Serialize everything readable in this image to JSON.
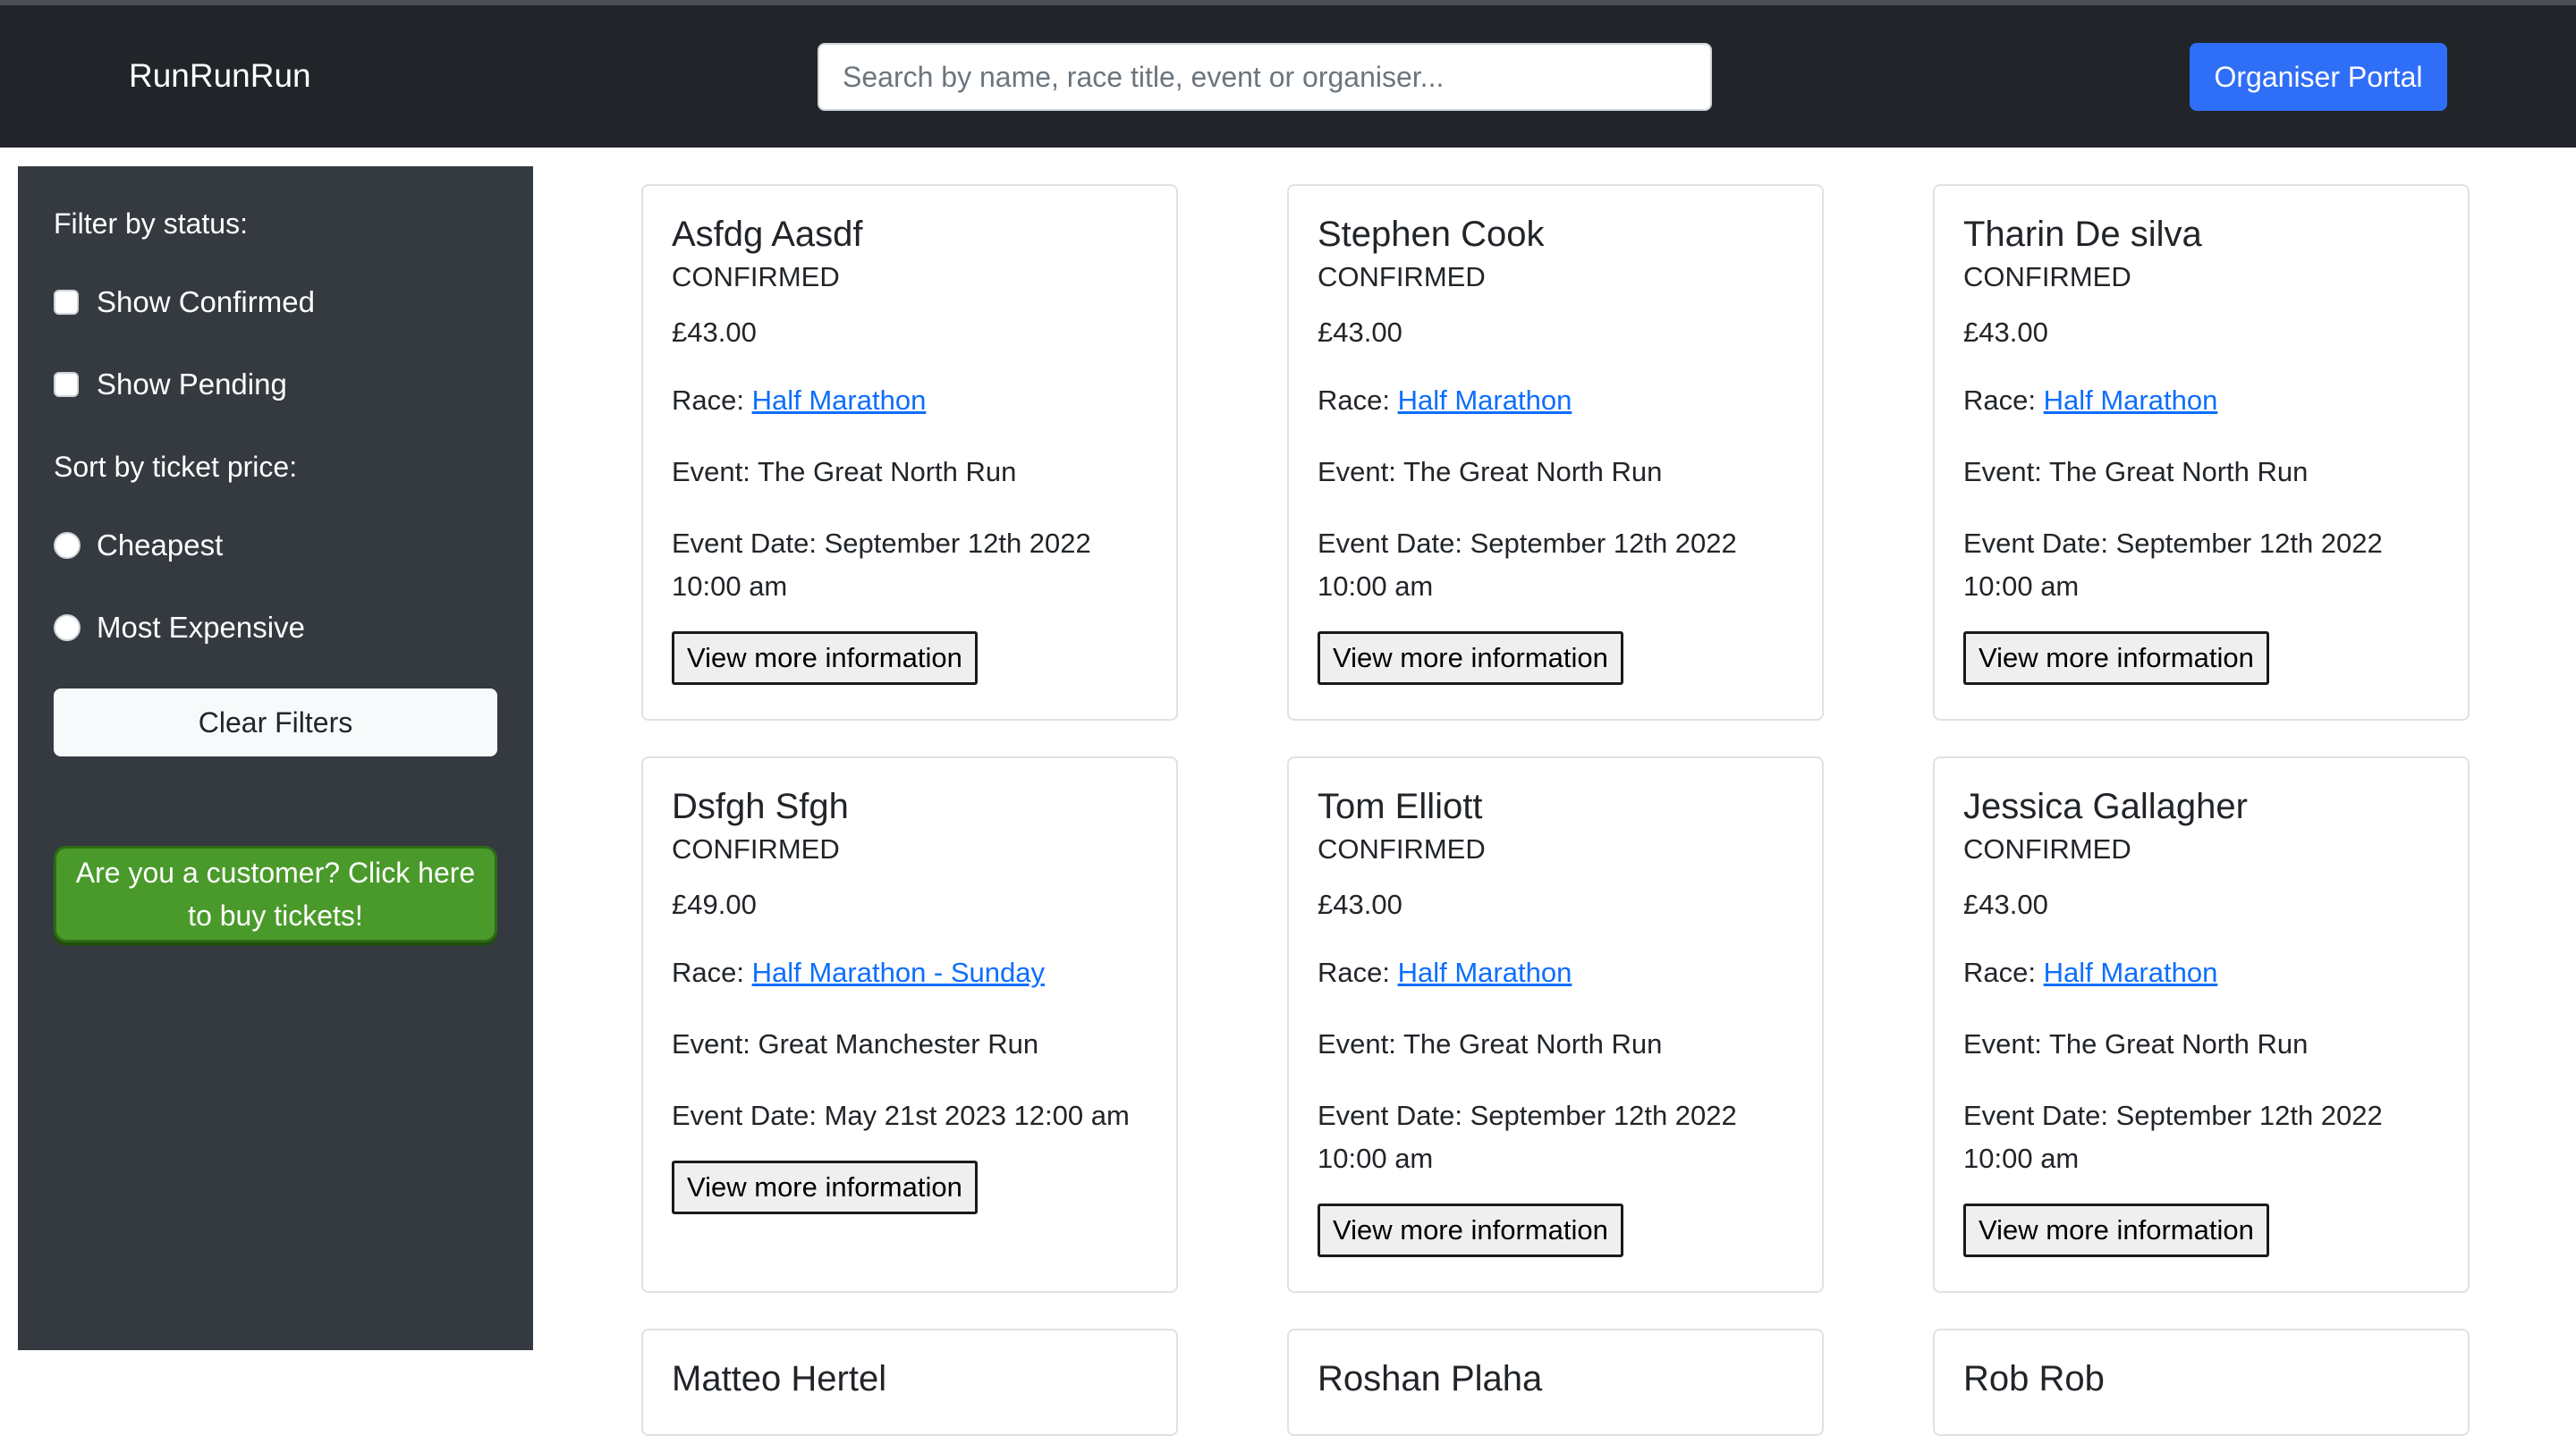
{
  "navbar": {
    "brand": "RunRunRun",
    "search_placeholder": "Search by name, race title, event or organiser...",
    "organiser_portal": "Organiser Portal"
  },
  "sidebar": {
    "filter_heading": "Filter by status:",
    "show_confirmed": "Show Confirmed",
    "show_pending": "Show Pending",
    "sort_heading": "Sort by ticket price:",
    "cheapest": "Cheapest",
    "most_expensive": "Most Expensive",
    "clear_filters": "Clear Filters",
    "customer_button": "Are you a customer? Click here to buy tickets!"
  },
  "labels": {
    "race": "Race: ",
    "event": "Event: ",
    "event_date": "Event Date: ",
    "view_more": "View more information"
  },
  "cards": [
    {
      "name": "Asfdg Aasdf",
      "status": "CONFIRMED",
      "price": "£43.00",
      "race": "Half Marathon",
      "event": "The Great North Run",
      "date": "September 12th 2022 10:00 am"
    },
    {
      "name": "Stephen Cook",
      "status": "CONFIRMED",
      "price": "£43.00",
      "race": "Half Marathon",
      "event": "The Great North Run",
      "date": "September 12th 2022 10:00 am"
    },
    {
      "name": "Tharin De silva",
      "status": "CONFIRMED",
      "price": "£43.00",
      "race": "Half Marathon",
      "event": "The Great North Run",
      "date": "September 12th 2022 10:00 am"
    },
    {
      "name": "Dsfgh Sfgh",
      "status": "CONFIRMED",
      "price": "£49.00",
      "race": "Half Marathon - Sunday",
      "event": "Great Manchester Run",
      "date": "May 21st 2023 12:00 am"
    },
    {
      "name": "Tom Elliott",
      "status": "CONFIRMED",
      "price": "£43.00",
      "race": "Half Marathon",
      "event": "The Great North Run",
      "date": "September 12th 2022 10:00 am"
    },
    {
      "name": "Jessica Gallagher",
      "status": "CONFIRMED",
      "price": "£43.00",
      "race": "Half Marathon",
      "event": "The Great North Run",
      "date": "September 12th 2022 10:00 am"
    },
    {
      "name": "Matteo Hertel"
    },
    {
      "name": "Roshan Plaha"
    },
    {
      "name": "Rob Rob"
    }
  ]
}
